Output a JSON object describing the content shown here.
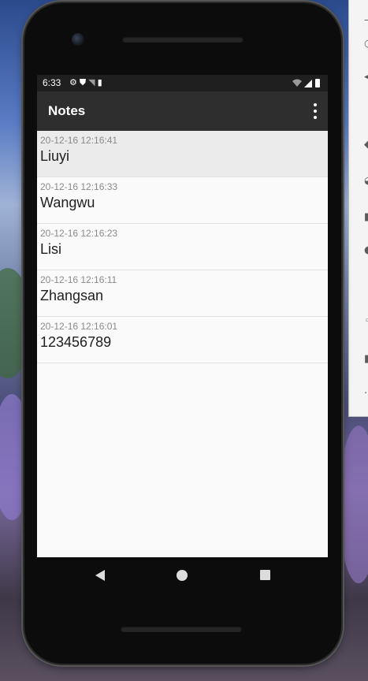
{
  "status_bar": {
    "time": "6:33",
    "left_icons": [
      "gear-icon",
      "shield-icon",
      "wifi-question-icon",
      "sd-card-icon"
    ],
    "right_icons": [
      "wifi-icon",
      "signal-icon",
      "battery-icon"
    ]
  },
  "app_bar": {
    "title": "Notes",
    "overflow_icon": "more-vert-icon"
  },
  "notes": [
    {
      "time": "20-12-16 12:16:41",
      "title": "Liuyi",
      "selected": true
    },
    {
      "time": "20-12-16 12:16:33",
      "title": "Wangwu",
      "selected": false
    },
    {
      "time": "20-12-16 12:16:23",
      "title": "Lisi",
      "selected": false
    },
    {
      "time": "20-12-16 12:16:11",
      "title": "Zhangsan",
      "selected": false
    },
    {
      "time": "20-12-16 12:16:01",
      "title": "123456789",
      "selected": false
    }
  ],
  "nav_bar": {
    "back_icon": "back-triangle-icon",
    "home_icon": "home-circle-icon",
    "recents_icon": "recents-square-icon"
  },
  "colors": {
    "app_bar": "#2e2e2e",
    "status_bar": "#1f1f1f",
    "list_background": "#fafafa",
    "selected_row": "#ebebeb"
  }
}
